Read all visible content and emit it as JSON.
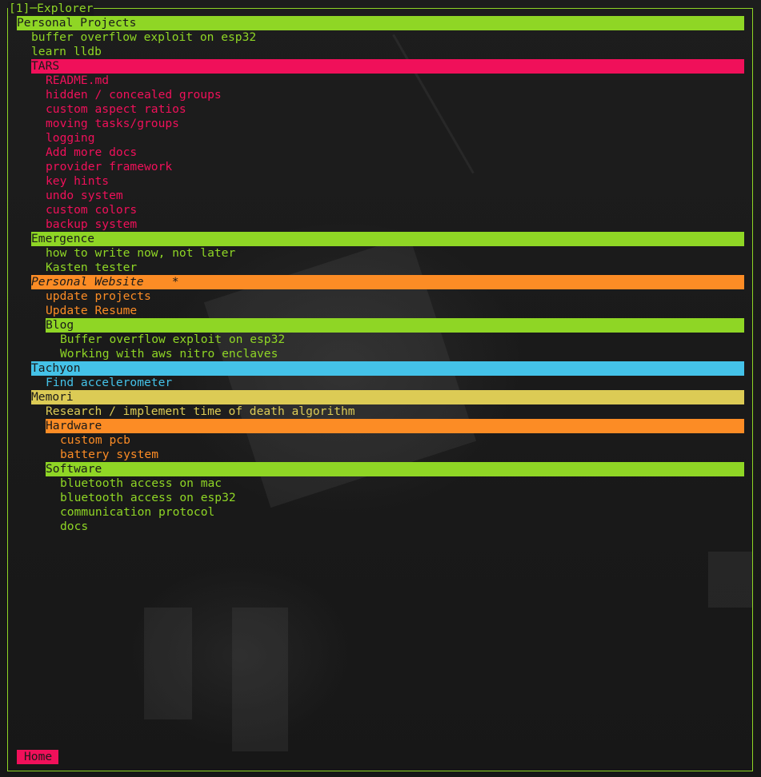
{
  "colors": {
    "green": "#8fd625",
    "red": "#f0105a",
    "orange": "#fc8c25",
    "cyan": "#44c2e8",
    "yellow": "#dccb55",
    "background": "#1a1a1a"
  },
  "panel": {
    "title": "[1]─Explorer"
  },
  "tree": [
    {
      "label": "Personal Projects",
      "depth": 0,
      "color": "#8fd625",
      "header": true
    },
    {
      "label": "buffer overflow exploit on esp32",
      "depth": 1,
      "color": "#8fd625"
    },
    {
      "label": "learn lldb",
      "depth": 1,
      "color": "#8fd625"
    },
    {
      "label": "TARS",
      "depth": 1,
      "color": "#f0105a",
      "header": true
    },
    {
      "label": "README.md",
      "depth": 2,
      "color": "#f0105a"
    },
    {
      "label": "hidden / concealed groups",
      "depth": 2,
      "color": "#f0105a"
    },
    {
      "label": "custom aspect ratios",
      "depth": 2,
      "color": "#f0105a"
    },
    {
      "label": "moving tasks/groups",
      "depth": 2,
      "color": "#f0105a"
    },
    {
      "label": "logging",
      "depth": 2,
      "color": "#f0105a"
    },
    {
      "label": "Add more docs",
      "depth": 2,
      "color": "#f0105a"
    },
    {
      "label": "provider framework",
      "depth": 2,
      "color": "#f0105a"
    },
    {
      "label": "key hints",
      "depth": 2,
      "color": "#f0105a"
    },
    {
      "label": "undo system",
      "depth": 2,
      "color": "#f0105a"
    },
    {
      "label": "custom colors",
      "depth": 2,
      "color": "#f0105a"
    },
    {
      "label": "backup system",
      "depth": 2,
      "color": "#f0105a"
    },
    {
      "label": "Emergence",
      "depth": 1,
      "color": "#8fd625",
      "header": true
    },
    {
      "label": "how to write now, not later",
      "depth": 2,
      "color": "#8fd625"
    },
    {
      "label": "Kasten tester",
      "depth": 2,
      "color": "#8fd625"
    },
    {
      "label": "Personal Website    *",
      "depth": 1,
      "color": "#fc8c25",
      "header": true,
      "italic": true
    },
    {
      "label": "update projects",
      "depth": 2,
      "color": "#fc8c25"
    },
    {
      "label": "Update Resume",
      "depth": 2,
      "color": "#fc8c25"
    },
    {
      "label": "Blog",
      "depth": 2,
      "color": "#8fd625",
      "header": true
    },
    {
      "label": "Buffer overflow exploit on esp32",
      "depth": 3,
      "color": "#8fd625"
    },
    {
      "label": "Working with aws nitro enclaves",
      "depth": 3,
      "color": "#8fd625"
    },
    {
      "label": "Tachyon",
      "depth": 1,
      "color": "#44c2e8",
      "header": true
    },
    {
      "label": "Find accelerometer",
      "depth": 2,
      "color": "#44c2e8"
    },
    {
      "label": "Memori",
      "depth": 1,
      "color": "#dccb55",
      "header": true
    },
    {
      "label": "Research / implement time of death algorithm",
      "depth": 2,
      "color": "#dccb55"
    },
    {
      "label": "Hardware",
      "depth": 2,
      "color": "#fc8c25",
      "header": true
    },
    {
      "label": "custom pcb",
      "depth": 3,
      "color": "#fc8c25"
    },
    {
      "label": "battery system",
      "depth": 3,
      "color": "#fc8c25"
    },
    {
      "label": "Software",
      "depth": 2,
      "color": "#8fd625",
      "header": true
    },
    {
      "label": "bluetooth access on mac",
      "depth": 3,
      "color": "#8fd625"
    },
    {
      "label": "bluetooth access on esp32",
      "depth": 3,
      "color": "#8fd625"
    },
    {
      "label": "communication protocol",
      "depth": 3,
      "color": "#8fd625"
    },
    {
      "label": "docs",
      "depth": 3,
      "color": "#8fd625"
    }
  ],
  "footer": {
    "label": "Home"
  }
}
